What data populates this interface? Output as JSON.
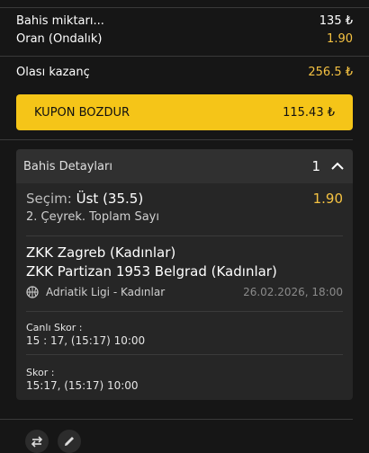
{
  "summary": {
    "stake_label": "Bahis miktarı...",
    "stake_value": "135 ₺",
    "odds_label": "Oran (Ondalık)",
    "odds_value": "1.90",
    "potential_label": "Olası kazanç",
    "potential_value": "256.5 ₺"
  },
  "cashout": {
    "label": "KUPON BOZDUR",
    "amount": "115.43 ₺"
  },
  "details": {
    "title": "Bahis Detayları",
    "count": "1",
    "selection_label": "Seçim:",
    "selection_value": "Üst (35.5)",
    "selection_odds": "1.90",
    "market": "2. Çeyrek. Toplam Sayı",
    "home_team": "ZKK Zagreb (Kadınlar)",
    "away_team": "ZKK Partizan 1953 Belgrad (Kadınlar)",
    "league": "Adriatik Ligi - Kadınlar",
    "datetime": "26.02.2026, 18:00",
    "live_score_label": "Canlı Skor :",
    "live_score_value": "15 : 17, (15:17) 10:00",
    "score_label": "Skor :",
    "score_value": "15:17, (15:17) 10:00"
  },
  "colors": {
    "accent": "#f5c518",
    "odds": "#f5c242",
    "background": "#161616",
    "panel": "#262626"
  },
  "icons": {
    "collapse": "chevron-up-icon",
    "sport": "basketball-icon",
    "tool_1": "swap-icon",
    "tool_2": "edit-icon"
  }
}
